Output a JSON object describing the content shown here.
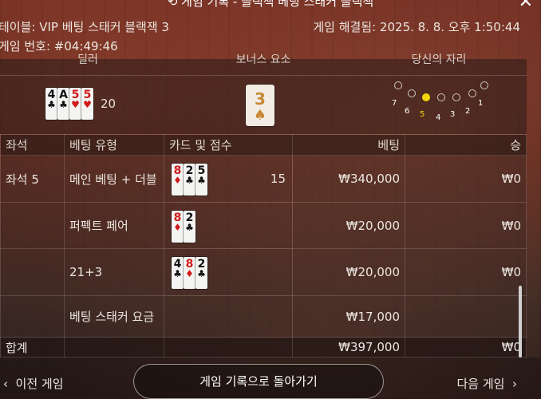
{
  "dialog": {
    "title": "게임 기록 - 블랙잭 베팅 스태커 블랙잭",
    "table_label": "테이블: VIP 베팅 스태커 블랙잭 3",
    "resolved_label": "게임 해결됨: 2025. 8. 8. 오후 1:50:44",
    "game_number_label": "게임 번호: #04:49:46"
  },
  "summary": {
    "dealer_header": "딜러",
    "bonus_header": "보너스 요소",
    "seat_header": "당신의 자리",
    "dealer_cards": [
      {
        "rank": "4",
        "suit": "♣",
        "color": "#111111"
      },
      {
        "rank": "A",
        "suit": "♣",
        "color": "#111111"
      },
      {
        "rank": "5",
        "suit": "♥",
        "color": "#d11a1a"
      },
      {
        "rank": "5",
        "suit": "♥",
        "color": "#d11a1a"
      }
    ],
    "dealer_score": "20",
    "bonus_card": {
      "rank": "3",
      "suit": "♠",
      "color": "#c88a3a"
    },
    "seats": [
      "7",
      "6",
      "5",
      "4",
      "3",
      "2",
      "1"
    ],
    "active_seat": "5"
  },
  "table": {
    "headers": {
      "seat": "좌석",
      "bet_type": "베팅 유형",
      "cards": "카드 및 점수",
      "bet": "베팅",
      "win": "승"
    },
    "rows": [
      {
        "seat": "좌석 5",
        "bet_type": "메인 베팅 + 더블",
        "cards": [
          {
            "rank": "8",
            "suit": "♦",
            "color": "#d11a1a"
          },
          {
            "rank": "2",
            "suit": "♣",
            "color": "#111111"
          },
          {
            "rank": "5",
            "suit": "♣",
            "color": "#111111"
          }
        ],
        "score": "15",
        "bet": "₩340,000",
        "win": "₩0"
      },
      {
        "seat": "",
        "bet_type": "퍼펙트 페어",
        "cards": [
          {
            "rank": "8",
            "suit": "♦",
            "color": "#d11a1a"
          },
          {
            "rank": "2",
            "suit": "♣",
            "color": "#111111"
          }
        ],
        "score": "",
        "bet": "₩20,000",
        "win": "₩0"
      },
      {
        "seat": "",
        "bet_type": "21+3",
        "cards": [
          {
            "rank": "4",
            "suit": "♣",
            "color": "#111111"
          },
          {
            "rank": "8",
            "suit": "♦",
            "color": "#d11a1a"
          },
          {
            "rank": "2",
            "suit": "♣",
            "color": "#111111"
          }
        ],
        "score": "",
        "bet": "₩20,000",
        "win": "₩0"
      },
      {
        "seat": "",
        "bet_type": "베팅 스태커 요금",
        "cards": [],
        "score": "",
        "bet": "₩17,000",
        "win": ""
      }
    ],
    "total": {
      "label": "합계",
      "bet": "₩397,000",
      "win": "₩0"
    }
  },
  "footer": {
    "prev_label": "이전 게임",
    "back_label": "게임 기록으로 돌아가기",
    "next_label": "다음 게임"
  }
}
